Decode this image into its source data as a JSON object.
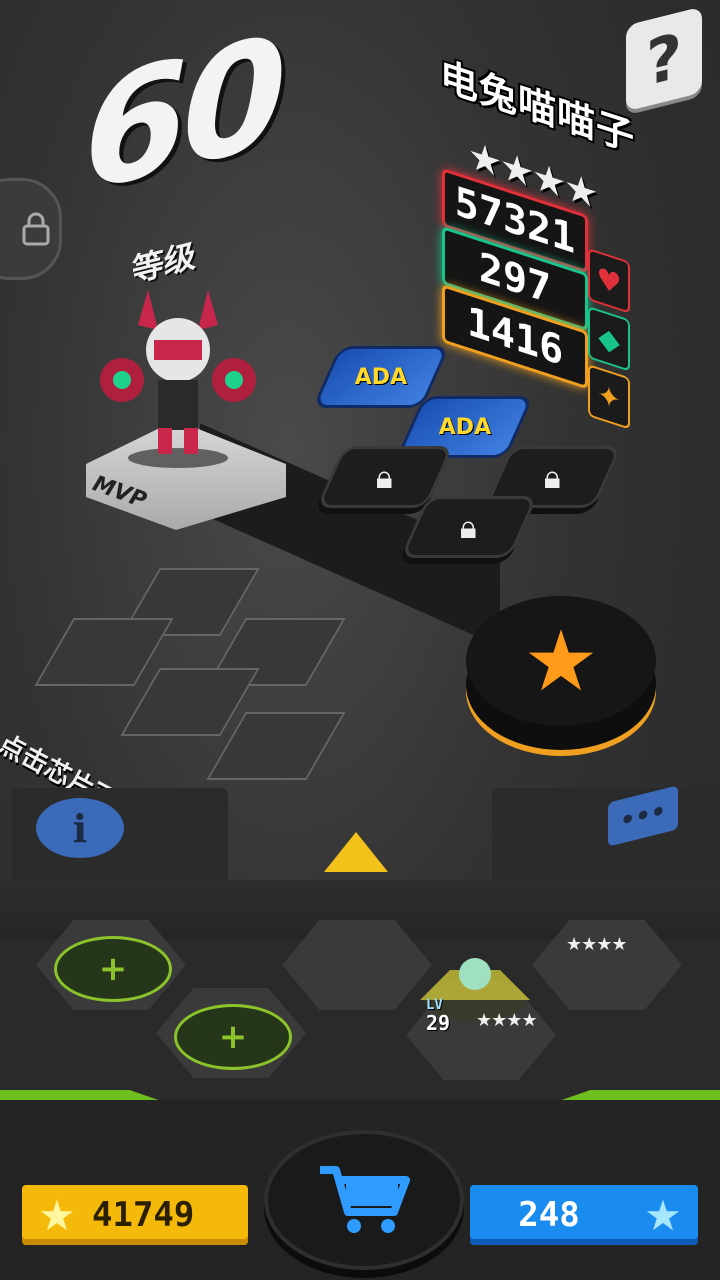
{
  "level": {
    "value": "60",
    "label": "等级"
  },
  "character": {
    "name": "电兔喵喵子",
    "stars": "★★★★",
    "stats": {
      "hp": "57321",
      "def": "297",
      "atk": "1416"
    }
  },
  "hint": "点击芯片可查看详情",
  "pedestal_tag": "MVP",
  "chip_label": "ADA",
  "mini_unit": {
    "lv_label": "LV",
    "lv_value": "29",
    "stars": "★★★★"
  },
  "footer": {
    "coins": "41749",
    "gems": "248"
  },
  "icons": {
    "help": "question-icon",
    "lock": "lock-icon",
    "info": "info-icon",
    "chat": "chat-icon",
    "shop": "cart-icon",
    "star_button": "star-icon"
  },
  "colors": {
    "hp": "#e0303a",
    "def": "#19c48a",
    "atk": "#f0a020",
    "coin": "#f5b90a",
    "gem": "#1a8cf0",
    "accent_green": "#6fbf1f"
  }
}
